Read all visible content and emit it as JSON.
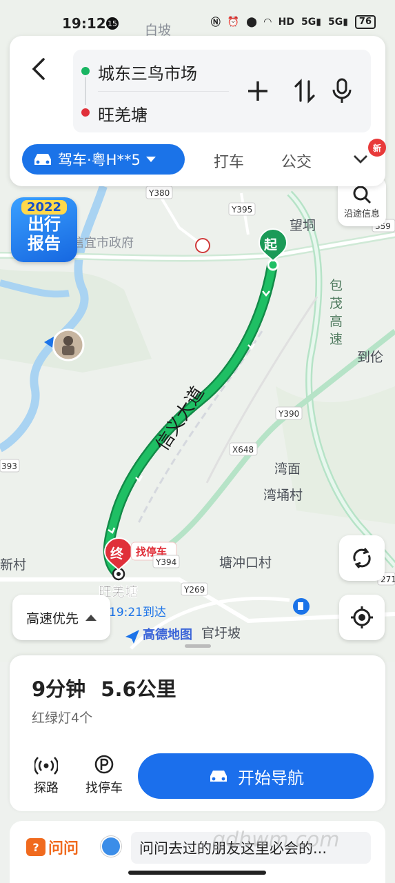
{
  "status_bar": {
    "time": "19:12",
    "notification_count": "15",
    "network_a": "5G",
    "network_b": "5G",
    "battery": "76"
  },
  "route_header": {
    "origin": "城东三鸟市场",
    "destination": "旺羌塘"
  },
  "modes": {
    "drive_label": "驾车·粤H**5",
    "taxi_label": "打车",
    "transit_label": "公交",
    "new_badge": "新"
  },
  "side_buttons": {
    "along_route_label": "沿途信息"
  },
  "promo": {
    "year": "2022",
    "line1": "出行",
    "line2": "报告"
  },
  "map_labels": {
    "road_y380": "Y380",
    "road_y395": "Y395",
    "road_y390": "Y390",
    "road_x648": "X648",
    "road_y269": "Y269",
    "road_y394": "Y394",
    "road_359": "359",
    "road_393": "393",
    "road_271": "271",
    "gov": "信宜市政府",
    "wangdong": "望垌",
    "expressway_1": "包",
    "expressway_2": "茂",
    "expressway_3": "高",
    "expressway_4": "速",
    "daolun": "到伦",
    "wanmian": "湾面",
    "wanyongcun": "湾埇村",
    "tangchongkou": "塘冲口村",
    "xincun": "新村",
    "guanyupo": "官圩坡",
    "gaode": "高德地图",
    "baipo": "白坡",
    "road_name": "信义大道",
    "start_marker": "起",
    "end_marker": "终",
    "find_parking_tag": "找停车",
    "end_name": "旺羌塘",
    "arrive_time": "19:21到达"
  },
  "preference": {
    "label": "高速优先"
  },
  "summary": {
    "duration": "9分钟",
    "distance": "5.6公里",
    "traffic_lights": "红绿灯4个"
  },
  "actions": {
    "explore": "探路",
    "parking": "找停车",
    "start_nav": "开始导航"
  },
  "ask": {
    "logo": "问问",
    "question": "问问去过的朋友这里必会的..."
  },
  "colors": {
    "accent": "#1b6fec",
    "route": "#1fae5b",
    "origin": "#19b562",
    "destination": "#e0303a"
  }
}
